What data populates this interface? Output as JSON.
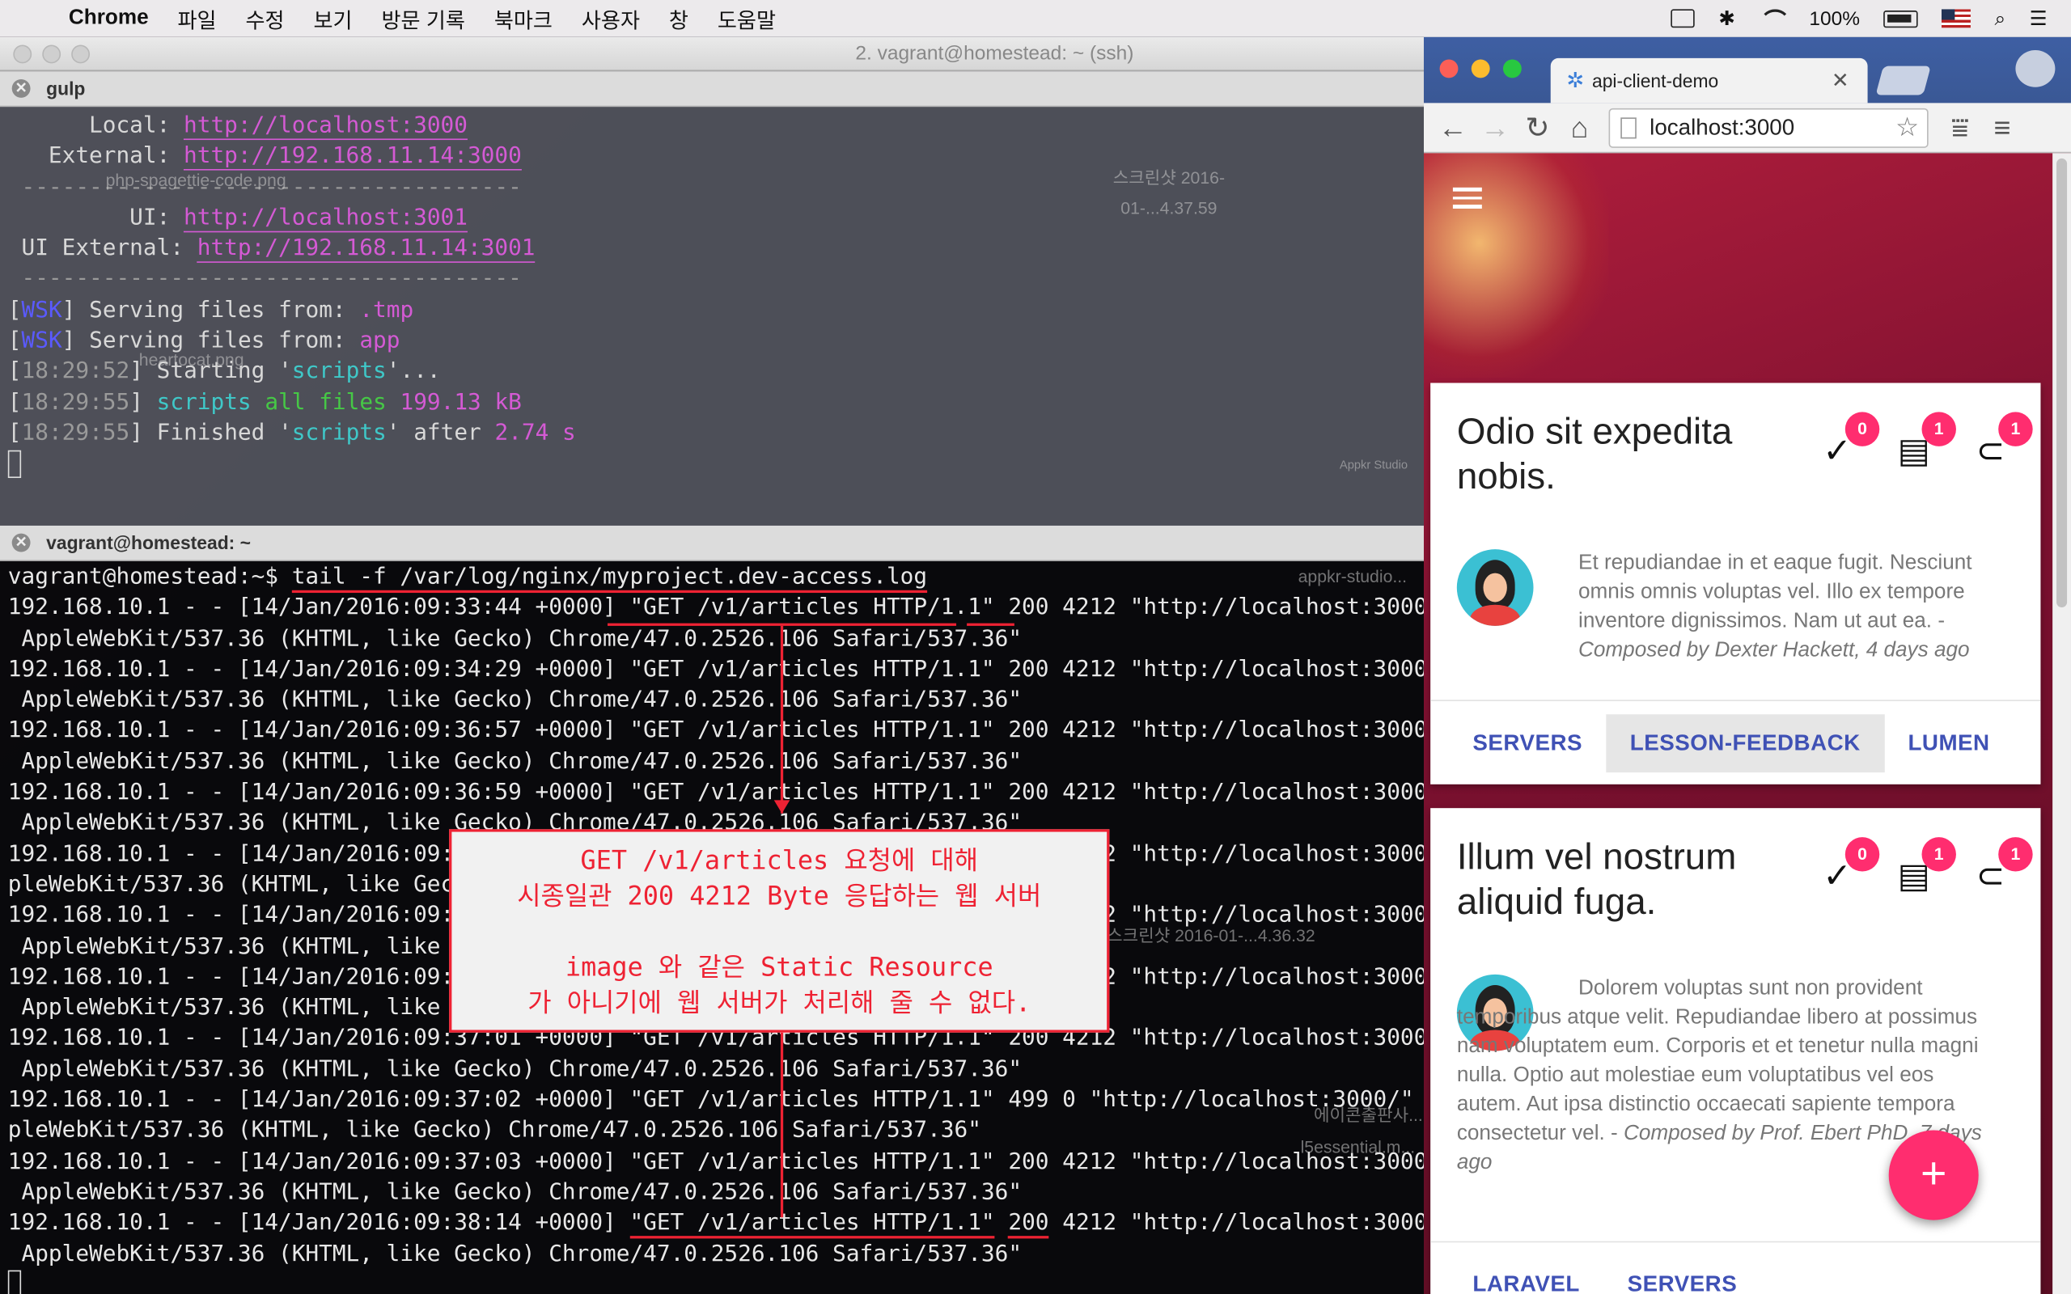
{
  "menubar": {
    "app": "Chrome",
    "menus": [
      "파일",
      "수정",
      "보기",
      "방문 기록",
      "북마크",
      "사용자",
      "창",
      "도움말"
    ],
    "battery": "100%"
  },
  "terminal": {
    "title": "2. vagrant@homestead: ~ (ssh)",
    "pane1_title": "gulp",
    "pane2_title": "vagrant@homestead: ~",
    "pane1": {
      "local_label": "      Local: ",
      "local_url": "http://localhost:3000",
      "external_label": "   External: ",
      "external_url": "http://192.168.11.14:3000",
      "sep": " -------------------------------------",
      "ui_label": "         UI: ",
      "ui_url": "http://localhost:3001",
      "uiext_label": " UI External: ",
      "uiext_url": "http://192.168.11.14:3001",
      "sep2": " -------------------------------------",
      "wsk": "WSK",
      "serve1": " Serving files from: ",
      "tmp": ".tmp",
      "serve2": " Serving files from: ",
      "app": "app",
      "t1": "18:29:52",
      "starting": " Starting '",
      "scripts": "scripts",
      "after_dots": "'...",
      "t2": "18:29:55",
      "scripts2": " scripts",
      "all_files": " all files",
      "size": " 199.13 kB",
      "t3": "18:29:55",
      "finished": " Finished '",
      "scripts3": "scripts",
      "after": "' after ",
      "dur": "2.74 s"
    },
    "pane2": {
      "prompt": "vagrant@homestead:~$ ",
      "cmd": "tail -f /var/log/nginx/myproject.dev-access.log",
      "lines": [
        "192.168.10.1 - - [14/Jan/2016:09:33:44 +0000] \"GET /v1/articles HTTP/1.1\" 200 4212 \"http://localhost:3000/\" \"M",
        " AppleWebKit/537.36 (KHTML, like Gecko) Chrome/47.0.2526.106 Safari/537.36\"",
        "192.168.10.1 - - [14/Jan/2016:09:34:29 +0000] \"GET /v1/articles HTTP/1.1\" 200 4212 \"http://localhost:3000/\" \"M",
        " AppleWebKit/537.36 (KHTML, like Gecko) Chrome/47.0.2526.106 Safari/537.36\"",
        "192.168.10.1 - - [14/Jan/2016:09:36:57 +0000] \"GET /v1/articles HTTP/1.1\" 200 4212 \"http://localhost:3000/\" \"M",
        " AppleWebKit/537.36 (KHTML, like Gecko) Chrome/47.0.2526.106 Safari/537.36\"",
        "192.168.10.1 - - [14/Jan/2016:09:36:59 +0000] \"GET /v1/articles HTTP/1.1\" 200 4212 \"http://localhost:3000/\" \"M",
        " AppleWebKit/537.36 (KHTML, like Gecko) Chrome/47.0.2526.106 Safari/537.36\"",
        "192.168.10.1 - - [14/Jan/2016:09:37:00 +0000] \"GET /v1/articles HTTP/1.1\" 200 4212 \"http://localhost:3000/\" \"Moz",
        "pleWebKit/537.36 (KHTML, like Gecko) Chrome/47.0.2526.106 Safari/537.36\"",
        "192.168.10.1 - - [14/Jan/2016:09:37:00 +0000] \"GET /v1/articles HTTP/1.1\" 200 4212 \"http://localhost:3000/\" \"M",
        " AppleWebKit/537.36 (KHTML, like Gecko) Chrome/47.0.2526.106 Safari/537.36\"",
        "192.168.10.1 - - [14/Jan/2016:09:37:01 +0000] \"GET /v1/articles HTTP/1.1\" 200 4212 \"http://localhost:3000/\" \"M",
        " AppleWebKit/537.36 (KHTML, like Gecko) Chrome/47.0.2526.106 Safari/537.36\"",
        "192.168.10.1 - - [14/Jan/2016:09:37:01 +0000] \"GET /v1/articles HTTP/1.1\" 200 4212 \"http://localhost:3000/\" \"M",
        " AppleWebKit/537.36 (KHTML, like Gecko) Chrome/47.0.2526.106 Safari/537.36\"",
        "192.168.10.1 - - [14/Jan/2016:09:37:02 +0000] \"GET /v1/articles HTTP/1.1\" 499 0 \"http://localhost:3000/\" \"Moz",
        "pleWebKit/537.36 (KHTML, like Gecko) Chrome/47.0.2526.106 Safari/537.36\"",
        "192.168.10.1 - - [14/Jan/2016:09:37:03 +0000] \"GET /v1/articles HTTP/1.1\" 200 4212 \"http://localhost:3000/\" \"M",
        " AppleWebKit/537.36 (KHTML, like Gecko) Chrome/47.0.2526.106 Safari/537.36\""
      ],
      "last_pre": "192.168.10.1 - - [14/Jan/2016:09:38:14 +0000] ",
      "last_req": "\"GET /v1/articles HTTP/1.1\"",
      "last_sp": " ",
      "last_code": "200",
      "last_post": " 4212 \"http://localhost:3000/\" \"M",
      "last_line2": " AppleWebKit/537.36 (KHTML, like Gecko) Chrome/47.0.2526.106 Safari/537.36\""
    },
    "annotation": {
      "line1": "GET /v1/articles 요청에 대해",
      "line2": "시종일관 200 4212 Byte 응답하는 웹 서버",
      "line3": "",
      "line4": "image 와 같은 Static Resource",
      "line5": "가 아니기에 웹 서버가 처리해 줄 수 없다."
    }
  },
  "desktop_labels": {
    "a": "php-spagettie-code.png",
    "b": "스크린샷 2016-01-...4.37.59",
    "c": "heartocat.png",
    "d": "Appkr Studio",
    "e": "appkr-studio...",
    "f": "스크린샷 2016-01-...4.36.32",
    "g": "에이콘출판사...",
    "h": "l5essential.m..."
  },
  "browser": {
    "tab_title": "api-client-demo",
    "url": "localhost:3000",
    "cards": [
      {
        "title": "Odio sit expedita nobis.",
        "badges": [
          "0",
          "1",
          "1"
        ],
        "body": "Et repudiandae in et eaque fugit. Nesciunt omnis omnis voluptas vel. Illo ex tempore inventore dignissimos. Nam ut aut ea. - ",
        "composed": "Composed by Dexter Hackett, 4 days ago",
        "actions": [
          "SERVERS",
          "LESSON-FEEDBACK",
          "LUMEN"
        ]
      },
      {
        "title": "Illum vel nostrum aliquid fuga.",
        "badges": [
          "0",
          "1",
          "1"
        ],
        "body": "Dolorem voluptas sunt non provident temporibus atque velit. Repudiandae libero at possimus nam voluptatem eum. Corporis et et tenetur nulla magni nulla. Optio aut molestiae eum voluptatibus vel eos autem. Aut ipsa distinctio occaecati sapiente tempora consectetur vel. - ",
        "composed": "Composed by Prof. Ebert PhD, 7 days ago",
        "actions": [
          "LARAVEL",
          "SERVERS"
        ]
      }
    ],
    "fab_label": "+"
  },
  "colors": {
    "accent_pink": "#ff2d6f",
    "indigo": "#3f51b5",
    "annot_red": "#e23333"
  }
}
